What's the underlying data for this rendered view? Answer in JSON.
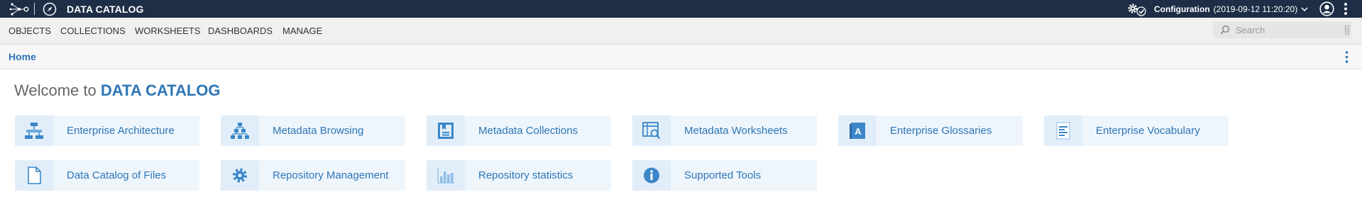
{
  "app": {
    "title": "DATA CATALOG",
    "configuration_label": "Configuration",
    "configuration_date": "(2019-09-12 11:20:20)"
  },
  "menu": {
    "items": [
      {
        "label": "OBJECTS"
      },
      {
        "label": "COLLECTIONS"
      },
      {
        "label": "WORKSHEETS"
      },
      {
        "label": "DASHBOARDS"
      },
      {
        "label": "MANAGE"
      }
    ]
  },
  "search": {
    "placeholder": "Search",
    "icon": "search-icon"
  },
  "breadcrumb": {
    "home": "Home"
  },
  "welcome": {
    "prefix": "Welcome to",
    "brand": "DATA CATALOG"
  },
  "tiles": [
    {
      "label": "Enterprise Architecture",
      "icon": "architecture-icon"
    },
    {
      "label": "Metadata Browsing",
      "icon": "hierarchy-icon"
    },
    {
      "label": "Metadata Collections",
      "icon": "collection-icon"
    },
    {
      "label": "Metadata Worksheets",
      "icon": "worksheet-search-icon"
    },
    {
      "label": "Enterprise Glossaries",
      "icon": "glossary-book-icon"
    },
    {
      "label": "Enterprise Vocabulary",
      "icon": "vocabulary-document-icon"
    },
    {
      "label": "Data Catalog of Files",
      "icon": "file-icon"
    },
    {
      "label": "Repository Management",
      "icon": "gear-icon"
    },
    {
      "label": "Repository statistics",
      "icon": "bar-chart-icon"
    },
    {
      "label": "Supported Tools",
      "icon": "info-icon"
    }
  ],
  "colors": {
    "topbar_bg": "#1d2e46",
    "accent": "#2e75b6",
    "tile_bg": "#eef6fc",
    "tile_icon_bg": "#e1eef9",
    "icon_blue": "#3a86c8"
  }
}
